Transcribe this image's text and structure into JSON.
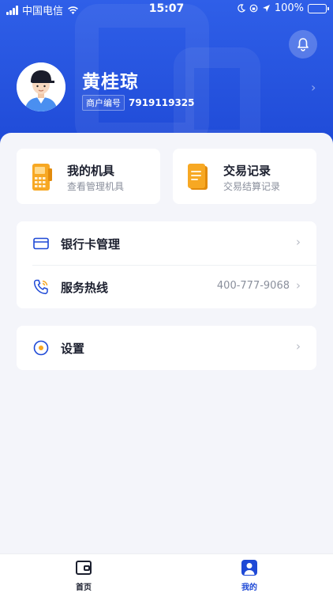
{
  "status_bar": {
    "carrier": "中国电信",
    "time": "15:07",
    "battery": "100%"
  },
  "profile": {
    "name": "黄桂琼",
    "merchant_label": "商户编号",
    "merchant_no": "7919119325"
  },
  "quick_actions": [
    {
      "title": "我的机具",
      "subtitle": "查看管理机具",
      "icon": "pos-terminal-icon"
    },
    {
      "title": "交易记录",
      "subtitle": "交易结算记录",
      "icon": "document-icon"
    }
  ],
  "menu": {
    "bank_card": {
      "label": "银行卡管理"
    },
    "hotline": {
      "label": "服务热线",
      "value": "400-777-9068"
    },
    "settings": {
      "label": "设置"
    }
  },
  "tabbar": {
    "tabs": [
      {
        "label": "首页",
        "icon": "wallet-icon",
        "active": false
      },
      {
        "label": "我的",
        "icon": "user-icon",
        "active": true
      }
    ]
  },
  "colors": {
    "primary": "#1e49d6",
    "accent_orange": "#f7a823",
    "text_dark": "#1b1f2e",
    "text_muted": "#8a8f9c"
  }
}
